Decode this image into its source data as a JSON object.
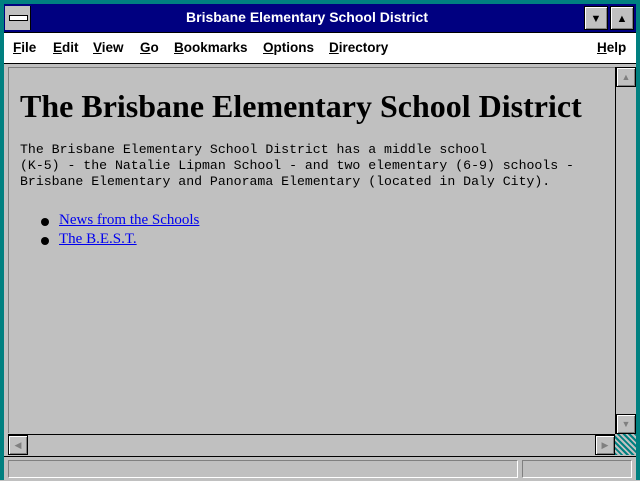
{
  "window": {
    "title": "Brisbane Elementary School District",
    "minimize_glyph": "▼",
    "maximize_glyph": "▲"
  },
  "menu": {
    "items": [
      "File",
      "Edit",
      "View",
      "Go",
      "Bookmarks",
      "Options",
      "Directory"
    ],
    "help": "Help"
  },
  "page": {
    "heading": "The Brisbane Elementary School District",
    "body_lines": [
      "The Brisbane Elementary School District has a middle school",
      "(K-5) - the Natalie Lipman School - and two elementary (6-9) schools -",
      "Brisbane Elementary and Panorama Elementary (located in Daly City)."
    ],
    "links": [
      "News from the Schools",
      "The B.E.S.T."
    ]
  },
  "scrollbars": {
    "up": "▲",
    "down": "▼",
    "left": "◀",
    "right": "▶"
  },
  "colors": {
    "frame": "#008080",
    "titlebar": "#000080",
    "background": "#c0c0c0",
    "link": "#0000ee"
  }
}
